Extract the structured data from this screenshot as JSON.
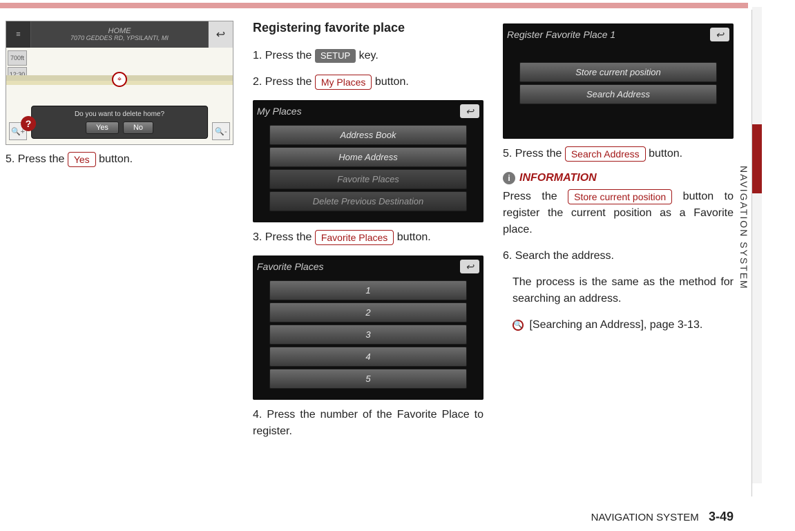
{
  "side_label": "NAVIGATION SYSTEM",
  "footer": {
    "section": "NAVIGATION SYSTEM",
    "page": "3-49"
  },
  "col1": {
    "map": {
      "title_line1": "HOME",
      "title_line2": "7070 GEDDES RD, YPSILANTI, MI",
      "scale_top": "700ft",
      "scale_bot": "12:30",
      "dialog_text": "Do you want to delete home?",
      "btn_yes": "Yes",
      "btn_no": "No"
    },
    "step5_pre": "5. Press the ",
    "step5_btn": "Yes",
    "step5_post": " button."
  },
  "col2": {
    "heading": "Registering favorite place",
    "step1_pre": "1. Press the ",
    "step1_btn": "SETUP",
    "step1_post": " key.",
    "step2_pre": "2. Press the ",
    "step2_btn": "My Places",
    "step2_post": " button.",
    "shot1": {
      "title": "My Places",
      "rows": [
        "Address Book",
        "Home Address",
        "Favorite Places",
        "Delete Previous Destination"
      ]
    },
    "step3_pre": "3. Press the ",
    "step3_btn": "Favorite Places",
    "step3_post": " button.",
    "shot2": {
      "title": "Favorite Places",
      "rows": [
        "1",
        "2",
        "3",
        "4",
        "5"
      ]
    },
    "step4": "4. Press the number of the Favorite Place to register."
  },
  "col3": {
    "shot": {
      "title": "Register Favorite Place 1",
      "rows": [
        "Store current position",
        "Search Address"
      ]
    },
    "step5_pre": "5. Press the ",
    "step5_btn": "Search Address",
    "step5_post": " button.",
    "info_label": "INFORMATION",
    "info_pre": "Press the ",
    "info_btn": "Store current position",
    "info_post": " button to register the current position as a Favorite place.",
    "step6a": "6. Search the address.",
    "step6b": "The process is the same as the method for searching an address.",
    "ref": "[Searching an Address], page 3-13."
  }
}
